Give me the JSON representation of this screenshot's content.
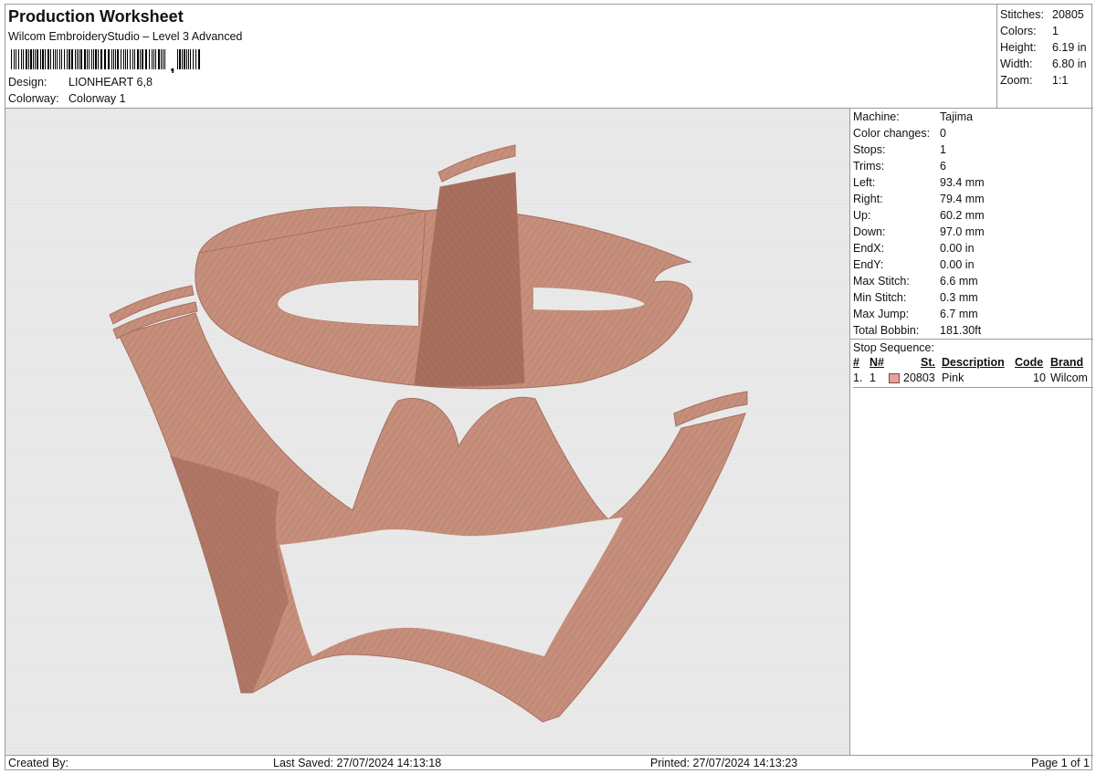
{
  "header": {
    "title": "Production Worksheet",
    "software": "Wilcom EmbroideryStudio – Level 3 Advanced",
    "barcode_suffix": ",",
    "design_label": "Design:",
    "design_value": "LIONHEART 6,8",
    "colorway_label": "Colorway:",
    "colorway_value": "Colorway 1"
  },
  "summary": {
    "stitches_label": "Stitches:",
    "stitches_value": "20805",
    "colors_label": "Colors:",
    "colors_value": "1",
    "height_label": "Height:",
    "height_value": "6.19 in",
    "width_label": "Width:",
    "width_value": "6.80 in",
    "zoom_label": "Zoom:",
    "zoom_value": "1:1"
  },
  "machine_info": [
    {
      "label": "Machine:",
      "value": "Tajima"
    },
    {
      "label": "Color changes:",
      "value": "0"
    },
    {
      "label": "Stops:",
      "value": "1"
    },
    {
      "label": "Trims:",
      "value": "6"
    },
    {
      "label": "Left:",
      "value": "93.4 mm"
    },
    {
      "label": "Right:",
      "value": "79.4 mm"
    },
    {
      "label": "Up:",
      "value": "60.2 mm"
    },
    {
      "label": "Down:",
      "value": "97.0 mm"
    },
    {
      "label": "EndX:",
      "value": "0.00 in"
    },
    {
      "label": "EndY:",
      "value": "0.00 in"
    },
    {
      "label": "Max Stitch:",
      "value": "6.6 mm"
    },
    {
      "label": "Min Stitch:",
      "value": "0.3 mm"
    },
    {
      "label": "Max Jump:",
      "value": "6.7 mm"
    },
    {
      "label": "Total Bobbin:",
      "value": "181.30ft"
    }
  ],
  "stop_sequence": {
    "title": "Stop Sequence:",
    "columns": [
      "#",
      "N#",
      "St.",
      "Description",
      "Code",
      "Brand"
    ],
    "rows": [
      {
        "num": "1.",
        "n": "1",
        "swatch_color": "#e8a09a",
        "st": "20803",
        "description": "Pink",
        "code": "10",
        "brand": "Wilcom"
      }
    ]
  },
  "design_colors": {
    "thread": "#c68f7c",
    "thread_dark": "#a86f5e",
    "thread_light": "#d8a896",
    "background": "#e9e9e9"
  },
  "footer": {
    "created_by": "Created By:",
    "last_saved": "Last Saved: 27/07/2024 14:13:18",
    "printed": "Printed: 27/07/2024 14:13:23",
    "page": "Page 1 of 1"
  }
}
